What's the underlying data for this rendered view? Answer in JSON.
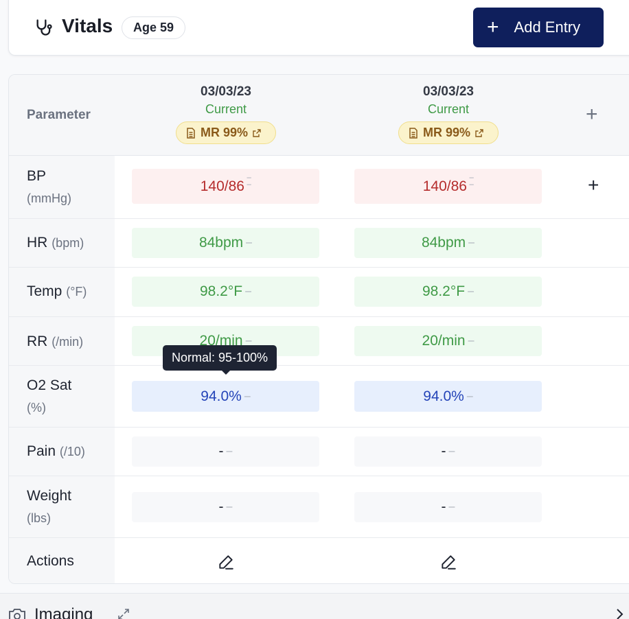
{
  "header": {
    "title": "Vitals",
    "age_badge": "Age 59",
    "add_label": "Add Entry",
    "add_icon": "plus-icon",
    "title_icon": "stethoscope-icon"
  },
  "table": {
    "param_header": "Parameter",
    "columns": [
      {
        "date": "03/03/23",
        "status": "Current",
        "badge": "MR 99%"
      },
      {
        "date": "03/03/23",
        "status": "Current",
        "badge": "MR 99%"
      }
    ],
    "rows": [
      {
        "label": "BP",
        "unit": "(mmHg)",
        "values": [
          "140/86",
          "140/86"
        ]
      },
      {
        "label": "HR",
        "unit": "(bpm)",
        "values": [
          "84bpm",
          "84bpm"
        ]
      },
      {
        "label": "Temp",
        "unit": "(°F)",
        "values": [
          "98.2°F",
          "98.2°F"
        ]
      },
      {
        "label": "RR",
        "unit": "(/min)",
        "values": [
          "20/min",
          "20/min"
        ]
      },
      {
        "label": "O2 Sat",
        "unit": "(%)",
        "values": [
          "94.0%",
          "94.0%"
        ]
      },
      {
        "label": "Pain",
        "unit": "(/10)",
        "values": [
          "-",
          "-"
        ]
      },
      {
        "label": "Weight",
        "unit": "(lbs)",
        "values": [
          "-",
          "-"
        ]
      }
    ],
    "actions_label": "Actions",
    "colors": {
      "high": "#b52c2c",
      "normal": "#3f9a46",
      "low": "#2444b8"
    }
  },
  "tooltip": "Normal: 95-100%",
  "imaging": {
    "title": "Imaging",
    "icon": "camera-icon"
  }
}
